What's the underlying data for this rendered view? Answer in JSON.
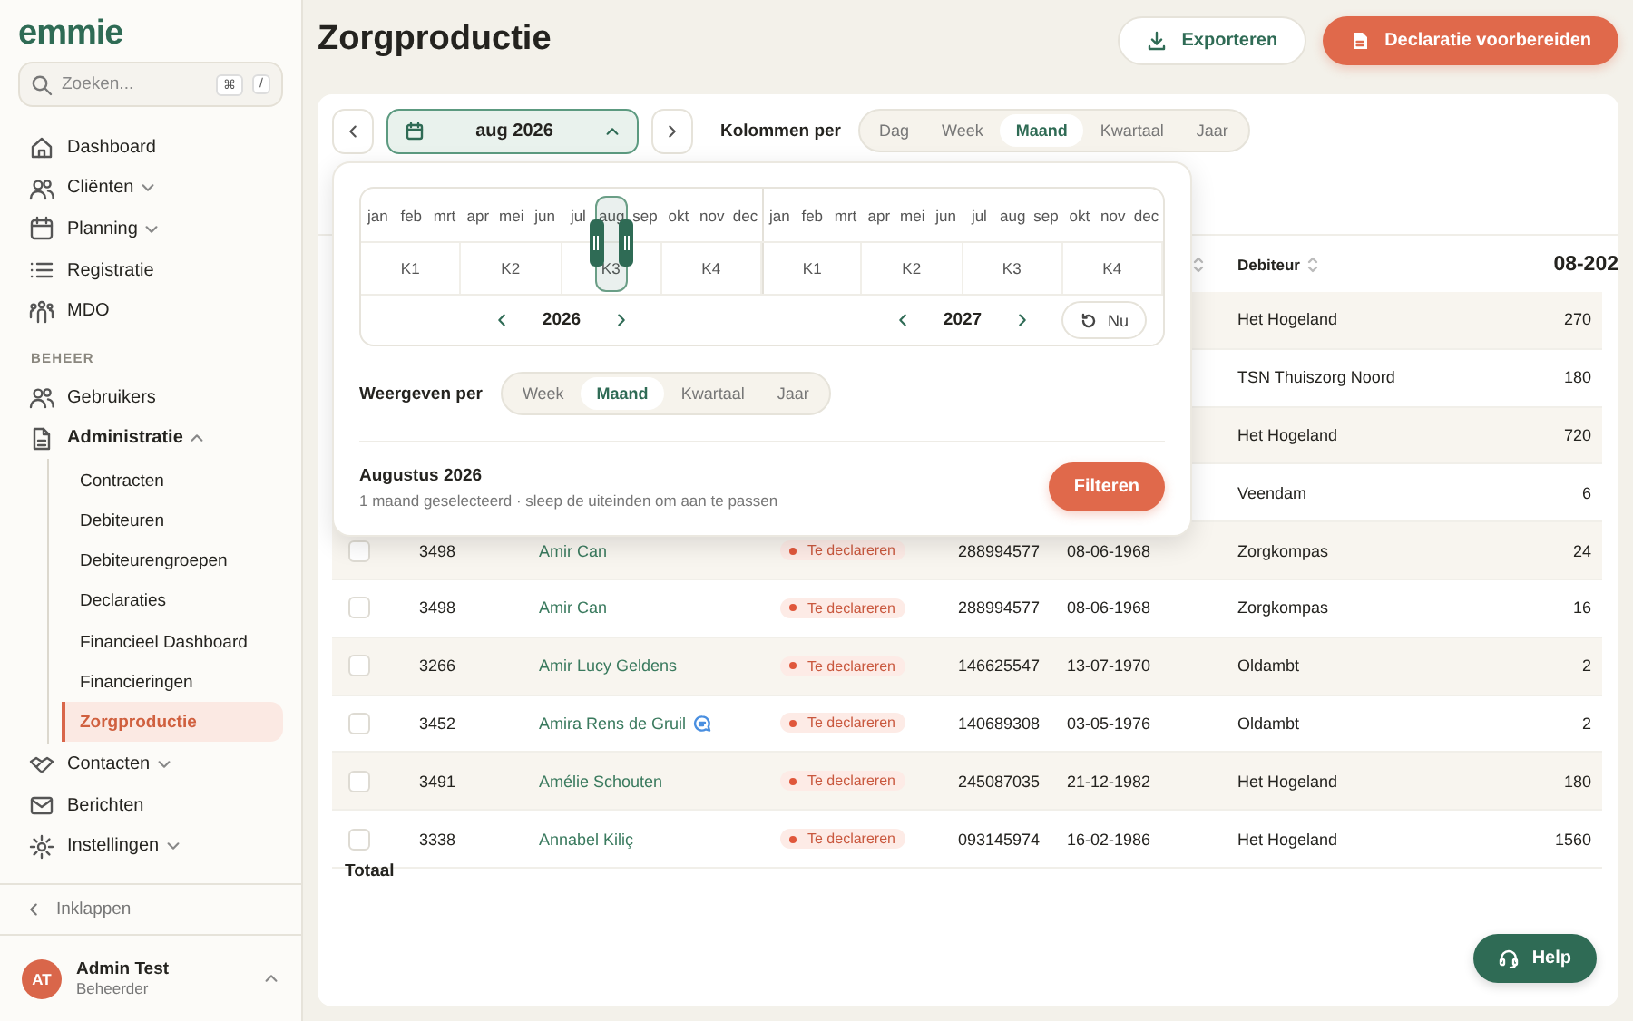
{
  "sidebar": {
    "logo": "emmie",
    "search": {
      "placeholder": "Zoeken...",
      "shortcut_keys": [
        "⌘",
        "/"
      ]
    },
    "groups": [
      {
        "items": [
          {
            "label": "Dashboard",
            "expandable": false,
            "expanded": false,
            "selected": false
          },
          {
            "label": "Cliënten",
            "expandable": true,
            "expanded": false,
            "selected": false
          },
          {
            "label": "Planning",
            "expandable": true,
            "expanded": false,
            "selected": false
          },
          {
            "label": "Registratie",
            "expandable": false,
            "expanded": false,
            "selected": false
          },
          {
            "label": "MDO",
            "expandable": false,
            "expanded": false,
            "selected": false
          }
        ]
      },
      {
        "heading": "BEHEER",
        "items": [
          {
            "label": "Gebruikers",
            "expandable": false,
            "expanded": false,
            "selected": false
          },
          {
            "label": "Administratie",
            "expandable": true,
            "expanded": true,
            "selected": false,
            "children": [
              {
                "label": "Contracten",
                "selected": false
              },
              {
                "label": "Debiteuren",
                "selected": false
              },
              {
                "label": "Debiteurengroepen",
                "selected": false
              },
              {
                "label": "Declaraties",
                "selected": false
              },
              {
                "label": "Financieel Dashboard",
                "selected": false
              },
              {
                "label": "Financieringen",
                "selected": false
              },
              {
                "label": "Zorgproductie",
                "selected": true
              }
            ]
          },
          {
            "label": "Contacten",
            "expandable": true,
            "expanded": false,
            "selected": false
          },
          {
            "label": "Berichten",
            "expandable": false,
            "expanded": false,
            "selected": false
          },
          {
            "label": "Instellingen",
            "expandable": true,
            "expanded": false,
            "selected": false
          }
        ]
      }
    ],
    "collapse": "Inklappen",
    "user": {
      "initials": "AT",
      "name": "Admin Test",
      "role": "Beheerder"
    }
  },
  "page": {
    "title": "Zorgproductie",
    "actions": [
      {
        "label": "Exporteren",
        "kind": "secondary"
      },
      {
        "label": "Declaratie voorbereiden",
        "kind": "primary"
      }
    ]
  },
  "toolbar": {
    "period": {
      "value": "aug 2026",
      "open": true
    },
    "columns_per": {
      "label": "Kolommen per",
      "options": [
        {
          "label": "Dag",
          "selected": false
        },
        {
          "label": "Week",
          "selected": false
        },
        {
          "label": "Maand",
          "selected": true
        },
        {
          "label": "Kwartaal",
          "selected": false
        },
        {
          "label": "Jaar",
          "selected": false
        }
      ]
    }
  },
  "period_popover": {
    "years": [
      {
        "year": "2026",
        "quarters": [
          "K1",
          "K2",
          "K3",
          "K4"
        ],
        "months": [
          {
            "label": "jan",
            "selected": false
          },
          {
            "label": "feb",
            "selected": false
          },
          {
            "label": "mrt",
            "selected": false
          },
          {
            "label": "apr",
            "selected": false
          },
          {
            "label": "mei",
            "selected": false
          },
          {
            "label": "jun",
            "selected": false
          },
          {
            "label": "jul",
            "selected": false
          },
          {
            "label": "aug",
            "selected": true
          },
          {
            "label": "sep",
            "selected": false
          },
          {
            "label": "okt",
            "selected": false
          },
          {
            "label": "nov",
            "selected": false
          },
          {
            "label": "dec",
            "selected": false
          }
        ]
      },
      {
        "year": "2027",
        "quarters": [
          "K1",
          "K2",
          "K3",
          "K4"
        ],
        "months": [
          {
            "label": "jan",
            "selected": false
          },
          {
            "label": "feb",
            "selected": false
          },
          {
            "label": "mrt",
            "selected": false
          },
          {
            "label": "apr",
            "selected": false
          },
          {
            "label": "mei",
            "selected": false
          },
          {
            "label": "jun",
            "selected": false
          },
          {
            "label": "jul",
            "selected": false
          },
          {
            "label": "aug",
            "selected": false
          },
          {
            "label": "sep",
            "selected": false
          },
          {
            "label": "okt",
            "selected": false
          },
          {
            "label": "nov",
            "selected": false
          },
          {
            "label": "dec",
            "selected": false
          }
        ]
      }
    ],
    "reset": "Nu",
    "display_per": {
      "label": "Weergeven per",
      "options": [
        {
          "label": "Week",
          "selected": false
        },
        {
          "label": "Maand",
          "selected": true
        },
        {
          "label": "Kwartaal",
          "selected": false
        },
        {
          "label": "Jaar",
          "selected": false
        }
      ]
    },
    "summary": {
      "title": "Augustus 2026",
      "subtitle": "1 maand geselecteerd · sleep de uiteinden om aan te passen"
    },
    "apply": "Filteren"
  },
  "table": {
    "columns": [
      {
        "sortable": true
      },
      {
        "label": "Debiteur",
        "sortable": true
      },
      {
        "label": "08-202",
        "sortable": false
      }
    ],
    "rows": [
      {
        "debiteur": "Het Hogeland",
        "amount": "270"
      },
      {
        "debiteur": "TSN Thuiszorg Noord",
        "amount": "180"
      },
      {
        "debiteur": "Het Hogeland",
        "amount": "720"
      },
      {
        "debiteur": "Veendam",
        "amount": "6"
      },
      {
        "checked": false,
        "id": "3498",
        "name": "Amir Can",
        "has_message": false,
        "status": "Te declareren",
        "bsn": "288994577",
        "birthdate": "08-06-1968",
        "debiteur": "Zorgkompas",
        "amount": "24"
      },
      {
        "checked": false,
        "id": "3498",
        "name": "Amir Can",
        "has_message": false,
        "status": "Te declareren",
        "bsn": "288994577",
        "birthdate": "08-06-1968",
        "debiteur": "Zorgkompas",
        "amount": "16"
      },
      {
        "checked": false,
        "id": "3266",
        "name": "Amir Lucy Geldens",
        "has_message": false,
        "status": "Te declareren",
        "bsn": "146625547",
        "birthdate": "13-07-1970",
        "debiteur": "Oldambt",
        "amount": "2"
      },
      {
        "checked": false,
        "id": "3452",
        "name": "Amira Rens de Gruil",
        "has_message": true,
        "status": "Te declareren",
        "bsn": "140689308",
        "birthdate": "03-05-1976",
        "debiteur": "Oldambt",
        "amount": "2"
      },
      {
        "checked": false,
        "id": "3491",
        "name": "Amélie Schouten",
        "has_message": false,
        "status": "Te declareren",
        "bsn": "245087035",
        "birthdate": "21-12-1982",
        "debiteur": "Het Hogeland",
        "amount": "180"
      },
      {
        "checked": false,
        "id": "3338",
        "name": "Annabel Kiliç",
        "has_message": false,
        "status": "Te declareren",
        "bsn": "093145974",
        "birthdate": "16-02-1986",
        "debiteur": "Het Hogeland",
        "amount": "1560"
      }
    ],
    "total_label": "Totaal"
  },
  "help": "Help"
}
